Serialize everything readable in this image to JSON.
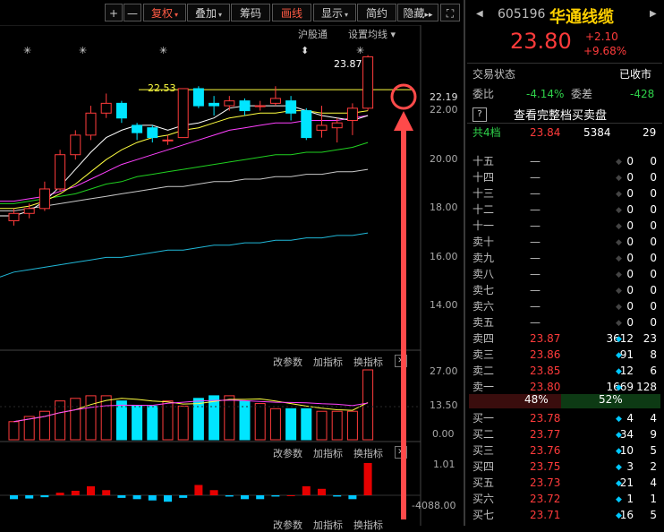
{
  "toolbar": {
    "plus": "+",
    "minus": "—",
    "fuquan": "复权",
    "diejia": "叠加",
    "chouma": "筹码",
    "huaxian": "画线",
    "xianshi": "显示",
    "jianyue": "简约",
    "yincang": "隐藏",
    "expand": "▸▸",
    "fullscreen": "⛶"
  },
  "chart": {
    "hugutong": "沪股通",
    "settings": "设置均线",
    "settings_arrow": "▾",
    "high_label": "23.87",
    "line_label": "22.53",
    "price_axis": [
      "22.19",
      "22.00",
      "20.00",
      "18.00",
      "16.00",
      "14.00"
    ],
    "vol_axis": [
      "27.00",
      "13.50",
      "0.00"
    ],
    "macd_axis": [
      "1.01",
      "-4088.00"
    ],
    "indicator_bar": {
      "param": "改参数",
      "add": "加指标",
      "switch": "换指标",
      "close": "✕"
    },
    "asterisk": "✳",
    "arrow_mark": "⬍",
    "colors": {
      "up": "#ff3b3b",
      "down": "#00e5ff",
      "ma5": "#ffffff",
      "ma10": "#ffff40",
      "ma20": "#ff40ff",
      "ma30": "#20d020",
      "ma60": "#c8c8c8",
      "ma120": "#20b8d8"
    }
  },
  "chart_data": {
    "type": "candlestick",
    "candles": [
      {
        "o": 17.1,
        "c": 17.4,
        "h": 17.6,
        "l": 16.9
      },
      {
        "o": 17.4,
        "c": 17.6,
        "h": 17.8,
        "l": 17.2
      },
      {
        "o": 17.6,
        "c": 18.4,
        "h": 18.7,
        "l": 17.5
      },
      {
        "o": 18.4,
        "c": 19.8,
        "h": 20.0,
        "l": 18.3
      },
      {
        "o": 19.8,
        "c": 20.6,
        "h": 20.8,
        "l": 19.6
      },
      {
        "o": 20.6,
        "c": 21.5,
        "h": 21.8,
        "l": 20.4
      },
      {
        "o": 21.5,
        "c": 21.9,
        "h": 22.3,
        "l": 21.3
      },
      {
        "o": 21.9,
        "c": 21.3,
        "h": 22.0,
        "l": 21.1
      },
      {
        "o": 21.0,
        "c": 20.7,
        "h": 21.1,
        "l": 20.4
      },
      {
        "o": 20.9,
        "c": 20.5,
        "h": 21.0,
        "l": 20.3
      },
      {
        "o": 20.4,
        "c": 20.4,
        "h": 20.6,
        "l": 20.2
      },
      {
        "o": 20.5,
        "c": 22.5,
        "h": 22.5,
        "l": 20.5
      },
      {
        "o": 22.5,
        "c": 21.8,
        "h": 22.6,
        "l": 21.7
      },
      {
        "o": 21.9,
        "c": 21.8,
        "h": 22.2,
        "l": 21.4
      },
      {
        "o": 21.8,
        "c": 22.0,
        "h": 22.2,
        "l": 21.6
      },
      {
        "o": 22.0,
        "c": 21.6,
        "h": 22.1,
        "l": 21.4
      },
      {
        "o": 21.8,
        "c": 21.8,
        "h": 22.0,
        "l": 21.6
      },
      {
        "o": 21.9,
        "c": 22.1,
        "h": 22.6,
        "l": 21.8
      },
      {
        "o": 22.0,
        "c": 21.5,
        "h": 22.2,
        "l": 21.2
      },
      {
        "o": 21.6,
        "c": 20.5,
        "h": 21.7,
        "l": 20.4
      },
      {
        "o": 20.8,
        "c": 21.0,
        "h": 21.8,
        "l": 20.5
      },
      {
        "o": 20.9,
        "c": 21.1,
        "h": 21.3,
        "l": 20.3
      },
      {
        "o": 21.2,
        "c": 21.7,
        "h": 21.9,
        "l": 20.6
      },
      {
        "o": 21.7,
        "c": 23.8,
        "h": 23.87,
        "l": 21.6
      }
    ],
    "ma": {
      "ma5": [
        17.3,
        17.5,
        17.9,
        18.5,
        19.2,
        19.9,
        20.5,
        20.8,
        21.0,
        21.0,
        20.8,
        21.0,
        21.1,
        21.3,
        21.7,
        21.8,
        21.8,
        21.8,
        21.8,
        21.6,
        21.4,
        21.3,
        21.2,
        21.4
      ],
      "ma10": [
        17.6,
        17.7,
        17.9,
        18.2,
        18.6,
        19.1,
        19.6,
        20.0,
        20.3,
        20.5,
        20.6,
        20.8,
        20.9,
        21.1,
        21.3,
        21.4,
        21.5,
        21.5,
        21.6,
        21.6,
        21.5,
        21.5,
        21.5,
        21.6
      ],
      "ma20": [
        17.9,
        18.0,
        18.1,
        18.3,
        18.5,
        18.8,
        19.1,
        19.4,
        19.6,
        19.8,
        20.0,
        20.2,
        20.4,
        20.6,
        20.8,
        20.9,
        21.0,
        21.1,
        21.1,
        21.2,
        21.2,
        21.2,
        21.3,
        21.4
      ],
      "ma30": [
        17.8,
        17.9,
        18.0,
        18.1,
        18.2,
        18.4,
        18.6,
        18.7,
        18.9,
        19.0,
        19.1,
        19.2,
        19.3,
        19.4,
        19.5,
        19.6,
        19.7,
        19.8,
        19.8,
        19.9,
        19.9,
        20.0,
        20.1,
        20.3
      ],
      "ma60": [
        17.5,
        17.6,
        17.7,
        17.8,
        17.9,
        18.0,
        18.1,
        18.2,
        18.3,
        18.4,
        18.5,
        18.5,
        18.6,
        18.7,
        18.7,
        18.8,
        18.8,
        18.9,
        18.9,
        19.0,
        19.0,
        19.1,
        19.1,
        19.2
      ],
      "ma120": [
        15.0,
        15.1,
        15.2,
        15.3,
        15.4,
        15.5,
        15.6,
        15.6,
        15.7,
        15.8,
        15.9,
        15.9,
        16.0,
        16.1,
        16.1,
        16.2,
        16.2,
        16.3,
        16.3,
        16.4,
        16.4,
        16.5,
        16.5,
        16.6
      ]
    },
    "volume": [
      7,
      9,
      11,
      15,
      16,
      17,
      17,
      15,
      13,
      13,
      15,
      13,
      16,
      17,
      17,
      15,
      14,
      12,
      12,
      12,
      11,
      11,
      11,
      27
    ],
    "macd": [
      -300,
      -250,
      -150,
      200,
      350,
      700,
      400,
      -200,
      -300,
      -400,
      -500,
      -200,
      800,
      400,
      -100,
      -300,
      -300,
      -100,
      0,
      700,
      500,
      -100,
      -300,
      2500
    ],
    "ylim": [
      13.2,
      24.0
    ]
  },
  "panel": {
    "code": "605196",
    "name": "华通线缆",
    "price": "23.80",
    "change": "+2.10",
    "change_pct": "+9.68%",
    "status_label": "交易状态",
    "status_value": "已收市",
    "weibi_label": "委比",
    "weibi_value": "-4.14%",
    "weicha_label": "委差",
    "weicha_value": "-428",
    "full_book_icon": "?",
    "full_book_label": "查看完整档买卖盘",
    "levels_label": "共4档",
    "levels_price": "23.84",
    "levels_vol": "5384",
    "levels_count": "29",
    "asks": [
      {
        "label": "十五",
        "price": "—",
        "vol": "0",
        "cnt": "0"
      },
      {
        "label": "十四",
        "price": "—",
        "vol": "0",
        "cnt": "0"
      },
      {
        "label": "十三",
        "price": "—",
        "vol": "0",
        "cnt": "0"
      },
      {
        "label": "十二",
        "price": "—",
        "vol": "0",
        "cnt": "0"
      },
      {
        "label": "十一",
        "price": "—",
        "vol": "0",
        "cnt": "0"
      },
      {
        "label": "卖十",
        "price": "—",
        "vol": "0",
        "cnt": "0"
      },
      {
        "label": "卖九",
        "price": "—",
        "vol": "0",
        "cnt": "0"
      },
      {
        "label": "卖八",
        "price": "—",
        "vol": "0",
        "cnt": "0"
      },
      {
        "label": "卖七",
        "price": "—",
        "vol": "0",
        "cnt": "0"
      },
      {
        "label": "卖六",
        "price": "—",
        "vol": "0",
        "cnt": "0"
      },
      {
        "label": "卖五",
        "price": "—",
        "vol": "0",
        "cnt": "0"
      },
      {
        "label": "卖四",
        "price": "23.87",
        "vol": "3612",
        "cnt": "23"
      },
      {
        "label": "卖三",
        "price": "23.86",
        "vol": "91",
        "cnt": "8"
      },
      {
        "label": "卖二",
        "price": "23.85",
        "vol": "12",
        "cnt": "6"
      },
      {
        "label": "卖一",
        "price": "23.80",
        "vol": "1669",
        "cnt": "128"
      }
    ],
    "sell_pct": "48%",
    "buy_pct": "52%",
    "buy_ratio": 0.52,
    "bids": [
      {
        "label": "买一",
        "price": "23.78",
        "vol": "4",
        "cnt": "4"
      },
      {
        "label": "买二",
        "price": "23.77",
        "vol": "34",
        "cnt": "9"
      },
      {
        "label": "买三",
        "price": "23.76",
        "vol": "10",
        "cnt": "5"
      },
      {
        "label": "买四",
        "price": "23.75",
        "vol": "3",
        "cnt": "2"
      },
      {
        "label": "买五",
        "price": "23.73",
        "vol": "21",
        "cnt": "4"
      },
      {
        "label": "买六",
        "price": "23.72",
        "vol": "1",
        "cnt": "1"
      },
      {
        "label": "买七",
        "price": "23.71",
        "vol": "16",
        "cnt": "5"
      }
    ]
  }
}
